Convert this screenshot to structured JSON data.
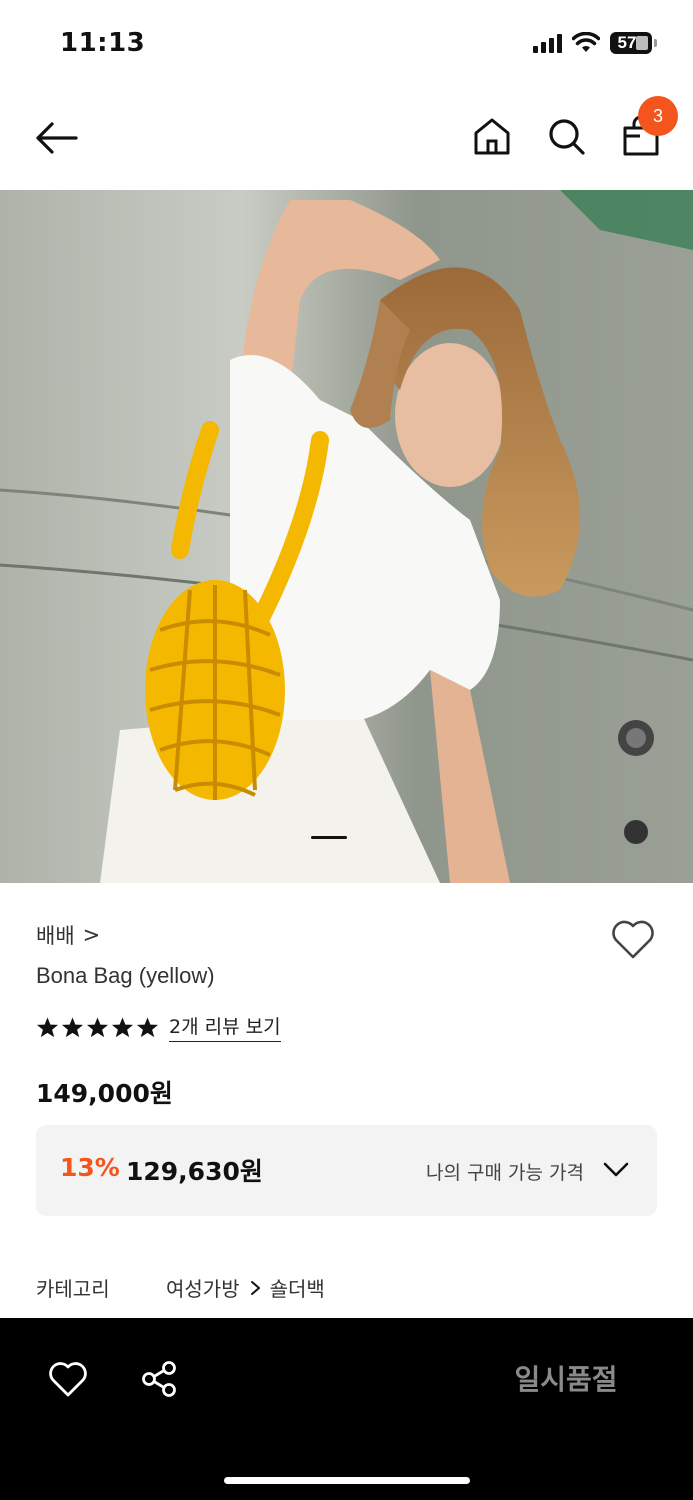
{
  "status_bar": {
    "time": "11:13",
    "battery": "57",
    "battery_level": 0.57
  },
  "nav": {
    "cart_count": "3",
    "icons": [
      "back-arrow-icon",
      "home-icon",
      "search-icon",
      "shopping-bag-icon"
    ]
  },
  "hero": {
    "alt_subject": "model wearing yellow chain bag",
    "slide_index": 1
  },
  "product": {
    "brand": "배배",
    "brand_chevron": ">",
    "name": "Bona Bag (yellow)",
    "rating": 5,
    "review_link": "2개 리뷰 보기",
    "original_price": "149,000원",
    "discount_rate": "13%",
    "discount_price": "129,630원",
    "my_price_label": "나의 구매 가능 가격"
  },
  "category": {
    "label": "카테고리",
    "path": [
      "여성가방",
      "숄더백"
    ]
  },
  "bottom_bar": {
    "soldout_label": "일시품절"
  },
  "colors": {
    "accent": "#f4551c",
    "bottom_bar": "#000000",
    "price_box": "#f3f3f3",
    "bag_yellow": "#f5b800"
  }
}
